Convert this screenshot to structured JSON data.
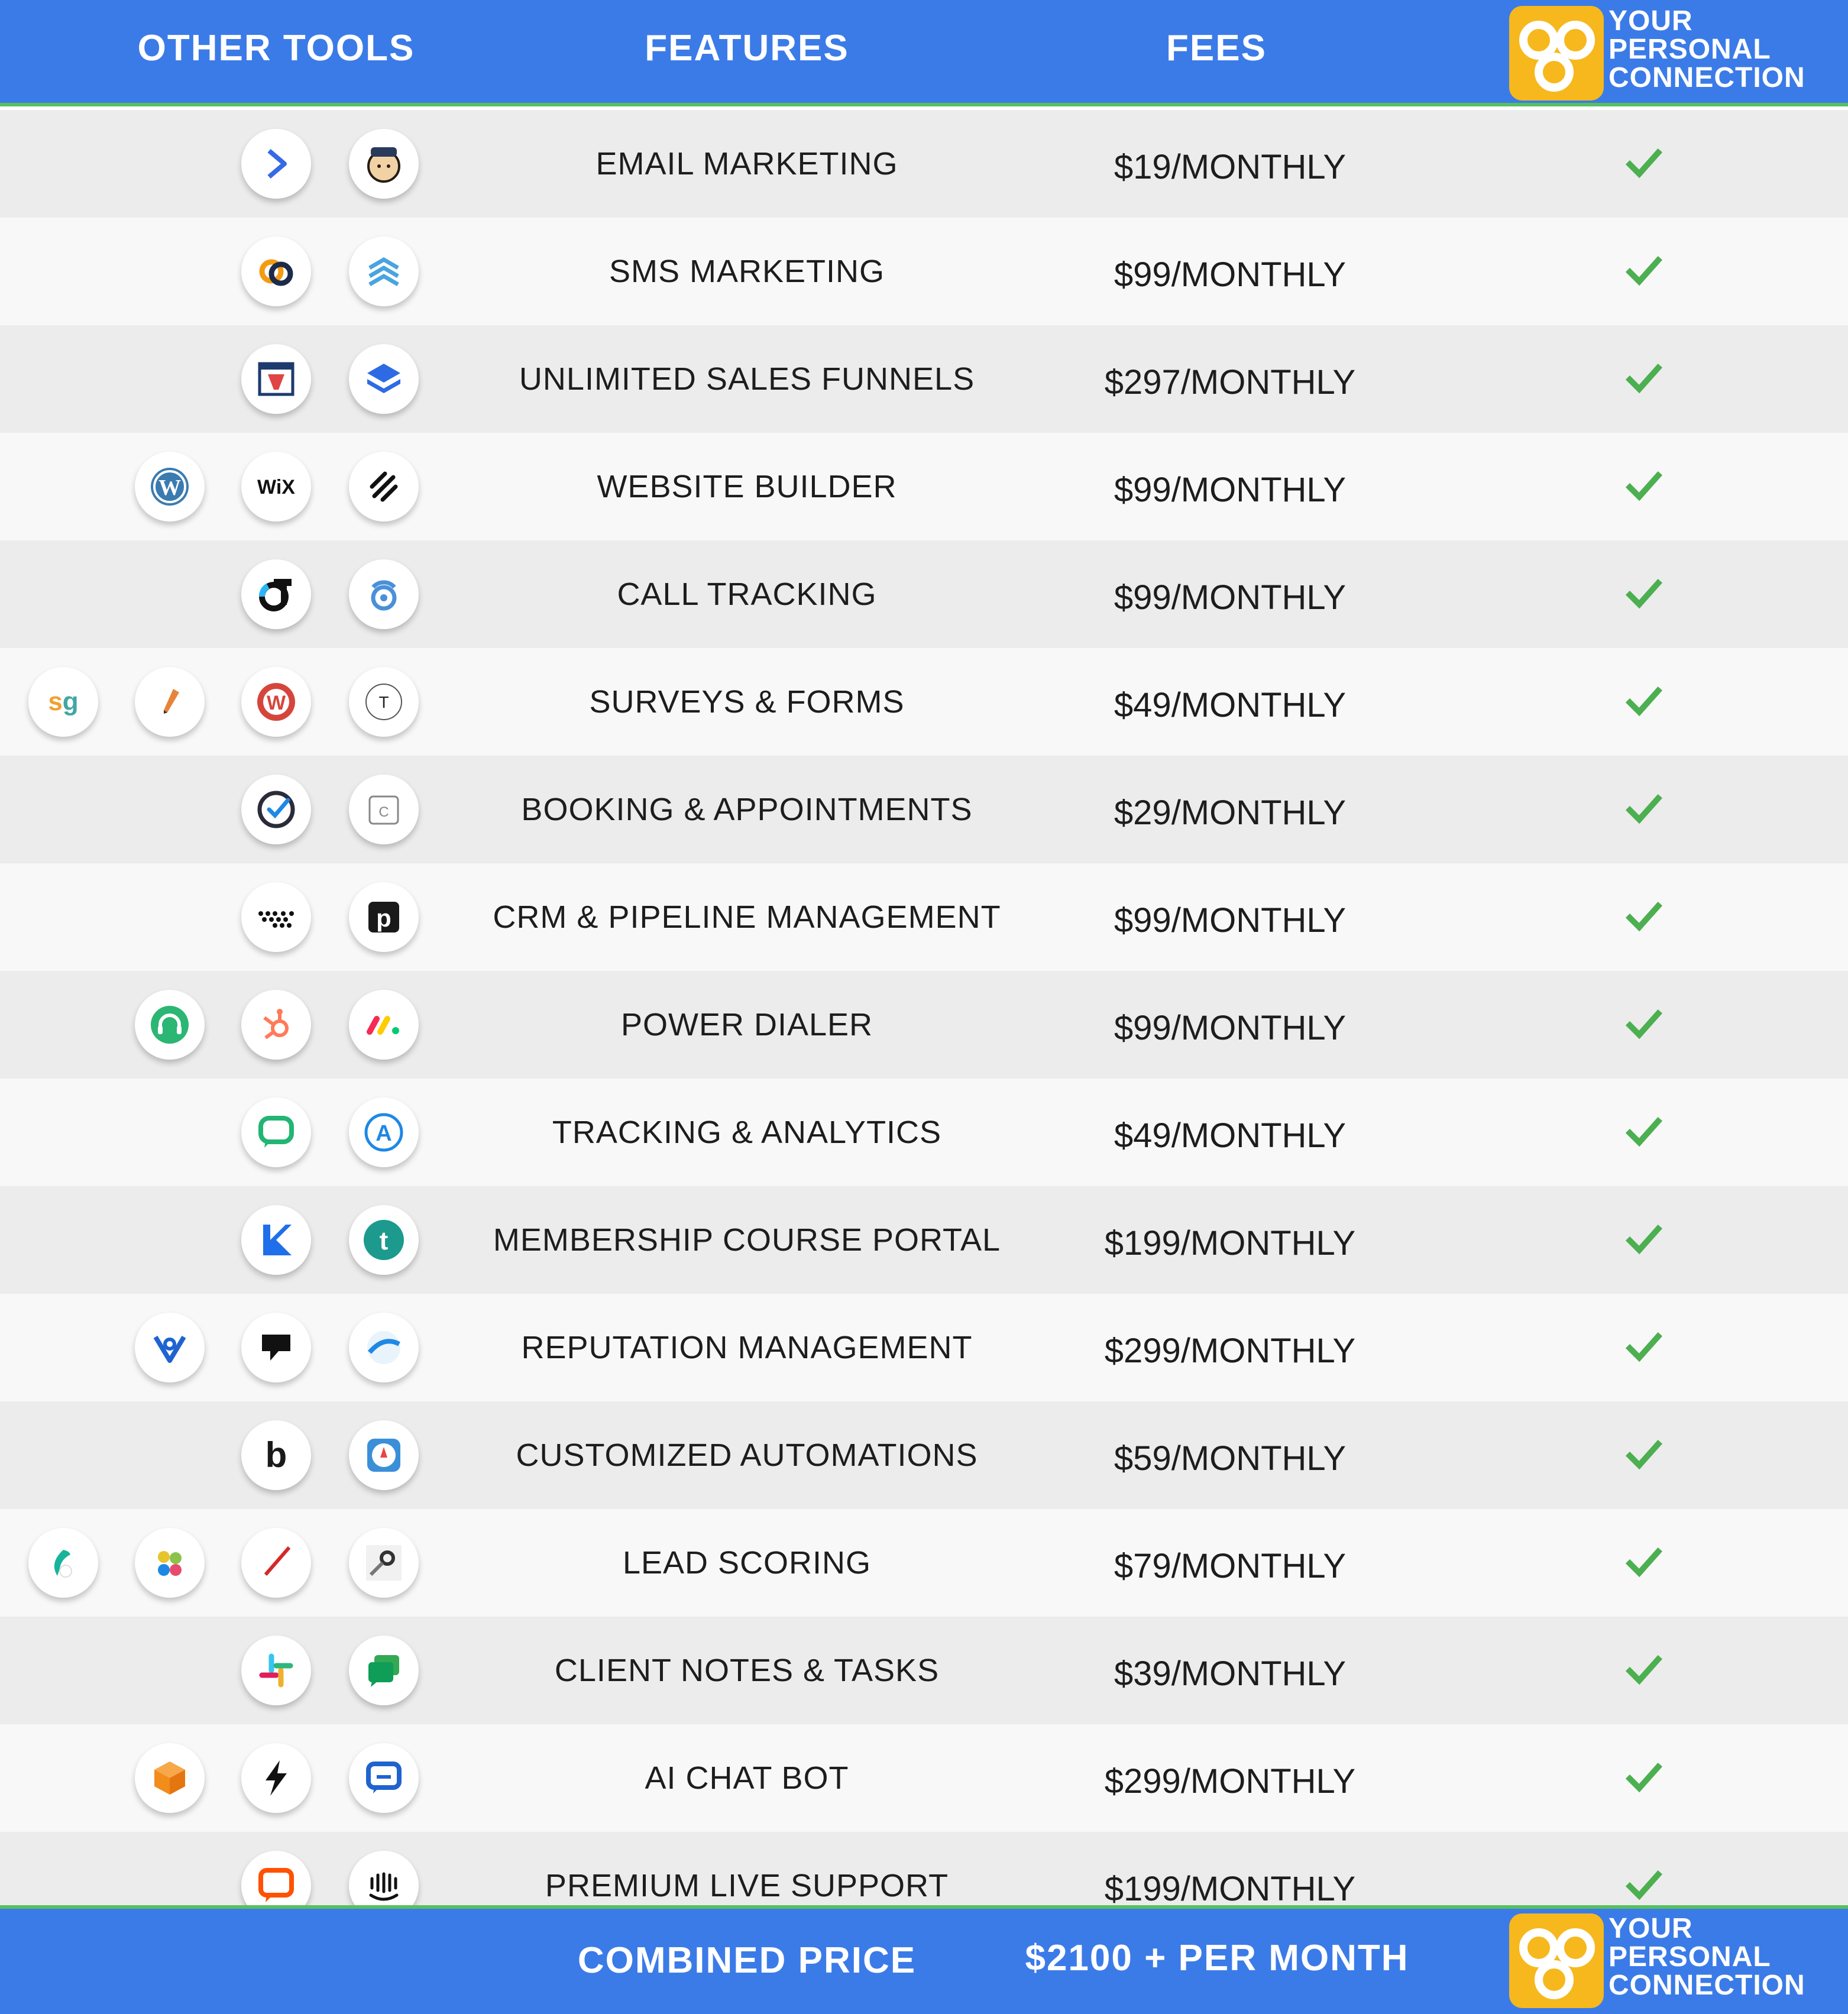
{
  "header": {
    "other_tools": "OTHER TOOLS",
    "features": "FEATURES",
    "fees": "FEES",
    "brand_line1": "YOUR",
    "brand_line2": "PERSONAL",
    "brand_line3": "CONNECTION"
  },
  "rows": [
    {
      "feature": "EMAIL MARKETING",
      "fee": "$19/MONTHLY",
      "tools": [
        "activecampaign-icon",
        "mailchimp-icon"
      ]
    },
    {
      "feature": "SMS MARKETING",
      "fee": "$99/MONTHLY",
      "tools": [
        "sms-link-icon",
        "stacked-chevrons-icon"
      ]
    },
    {
      "feature": "UNLIMITED SALES FUNNELS",
      "fee": "$297/MONTHLY",
      "tools": [
        "clickfunnels-icon",
        "layers-icon"
      ]
    },
    {
      "feature": "WEBSITE BUILDER",
      "fee": "$99/MONTHLY",
      "tools": [
        "wordpress-icon",
        "wix-icon",
        "squarespace-icon"
      ]
    },
    {
      "feature": "CALL TRACKING",
      "fee": "$99/MONTHLY",
      "tools": [
        "calltrack-icon",
        "callrail-icon"
      ]
    },
    {
      "feature": "SURVEYS & FORMS",
      "fee": "$49/MONTHLY",
      "tools": [
        "surveygizmo-icon",
        "pencil-icon",
        "wufoo-icon",
        "typeform-icon"
      ]
    },
    {
      "feature": "BOOKING & APPOINTMENTS",
      "fee": "$29/MONTHLY",
      "tools": [
        "check-circle-icon",
        "calendar-icon"
      ]
    },
    {
      "feature": "CRM & PIPELINE MANAGEMENT",
      "fee": "$99/MONTHLY",
      "tools": [
        "dots-icon",
        "pipedrive-icon"
      ]
    },
    {
      "feature": "POWER DIALER",
      "fee": "$99/MONTHLY",
      "tools": [
        "headset-icon",
        "hubspot-icon",
        "monday-icon"
      ]
    },
    {
      "feature": "TRACKING & ANALYTICS",
      "fee": "$49/MONTHLY",
      "tools": [
        "chat-bubble-icon",
        "analytics-icon"
      ]
    },
    {
      "feature": "MEMBERSHIP COURSE PORTAL",
      "fee": "$199/MONTHLY",
      "tools": [
        "kajabi-icon",
        "teachable-icon"
      ]
    },
    {
      "feature": "REPUTATION MANAGEMENT",
      "fee": "$299/MONTHLY",
      "tools": [
        "birdeye-icon",
        "podium-icon",
        "review-icon"
      ]
    },
    {
      "feature": "CUSTOMIZED AUTOMATIONS",
      "fee": "$59/MONTHLY",
      "tools": [
        "bubble-icon",
        "compass-icon"
      ]
    },
    {
      "feature": "LEAD SCORING",
      "fee": "$79/MONTHLY",
      "tools": [
        "leaf-icon",
        "petals-icon",
        "needle-icon",
        "search-tool-icon"
      ]
    },
    {
      "feature": "CLIENT NOTES & TASKS",
      "fee": "$39/MONTHLY",
      "tools": [
        "slack-icon",
        "google-chat-icon"
      ]
    },
    {
      "feature": "AI CHAT BOT",
      "fee": "$299/MONTHLY",
      "tools": [
        "cube-icon",
        "lightning-icon",
        "chat-bot-icon"
      ]
    },
    {
      "feature": "PREMIUM LIVE SUPPORT",
      "fee": "$199/MONTHLY",
      "tools": [
        "livechat-icon",
        "intercom-icon"
      ]
    }
  ],
  "footer": {
    "combined_label": "COMBINED PRICE",
    "combined_value": "$2100 + PER MONTH",
    "brand_line1": "YOUR",
    "brand_line2": "PERSONAL",
    "brand_line3": "CONNECTION"
  },
  "colors": {
    "band": "#3b7be8",
    "accent_green": "#58c05e",
    "check": "#4caf50",
    "brand_badge": "#f6b81d"
  }
}
